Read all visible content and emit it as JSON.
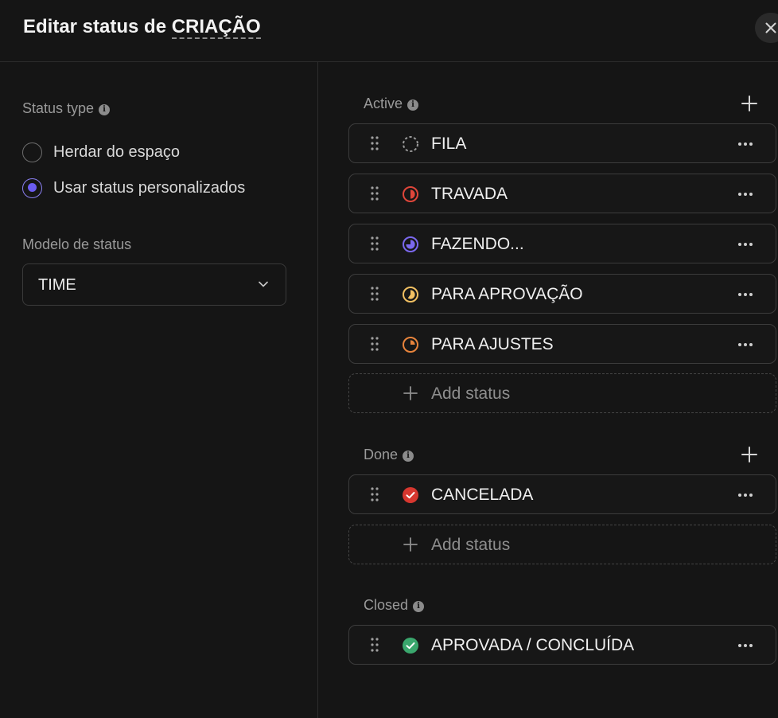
{
  "dialog": {
    "title_prefix": "Editar status de",
    "title_entity": "CRIAÇÃO",
    "close_icon": "close-icon"
  },
  "left": {
    "status_type_label": "Status type",
    "options": [
      {
        "label": "Herdar do espaço",
        "selected": false
      },
      {
        "label": "Usar status personalizados",
        "selected": true
      }
    ],
    "model_label": "Modelo de status",
    "model_value": "TIME"
  },
  "sections": {
    "active": {
      "label": "Active",
      "statuses": [
        {
          "name": "FILA",
          "icon": "dashed-circle-icon",
          "color": "#9a9a9a"
        },
        {
          "name": "TRAVADA",
          "icon": "progress-circle-icon",
          "color": "#e0463a"
        },
        {
          "name": "FAZENDO...",
          "icon": "progress-circle-icon",
          "color": "#7b68ee"
        },
        {
          "name": "PARA APROVAÇÃO",
          "icon": "progress-circle-icon",
          "color": "#f2c062"
        },
        {
          "name": "PARA AJUSTES",
          "icon": "progress-circle-icon",
          "color": "#e8843c"
        }
      ],
      "add_label": "Add status"
    },
    "done": {
      "label": "Done",
      "statuses": [
        {
          "name": "CANCELADA",
          "icon": "check-circle-icon",
          "color": "#d7372f"
        }
      ],
      "add_label": "Add status"
    },
    "closed": {
      "label": "Closed",
      "statuses": [
        {
          "name": "APROVADA / CONCLUÍDA",
          "icon": "check-circle-icon",
          "color": "#3aa76d"
        }
      ]
    }
  },
  "accent_color": "#6b5cf0"
}
